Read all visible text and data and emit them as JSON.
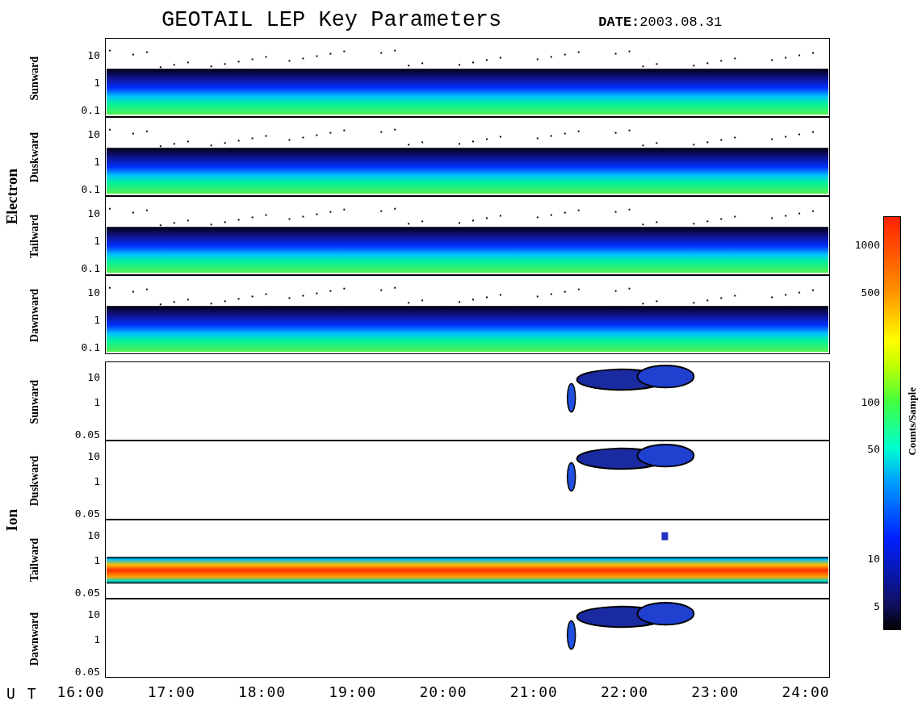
{
  "title": "GEOTAIL LEP Key Parameters",
  "date": {
    "label": "DATE:",
    "value": "2003.08.31"
  },
  "groups": [
    {
      "name": "Electron",
      "panels": [
        {
          "label": "Sunward",
          "kind": "electron",
          "yticks": [
            "10",
            "1",
            "0.1"
          ]
        },
        {
          "label": "Duskward",
          "kind": "electron",
          "yticks": [
            "10",
            "1",
            "0.1"
          ]
        },
        {
          "label": "Tailward",
          "kind": "electron",
          "yticks": [
            "10",
            "1",
            "0.1"
          ]
        },
        {
          "label": "Dawnward",
          "kind": "electron",
          "yticks": [
            "10",
            "1",
            "0.1"
          ]
        }
      ]
    },
    {
      "name": "Ion",
      "panels": [
        {
          "label": "Sunward",
          "kind": "ion-beam",
          "yticks": [
            "10",
            "1",
            "0.05"
          ]
        },
        {
          "label": "Duskward",
          "kind": "ion-beam",
          "yticks": [
            "10",
            "1",
            "0.05"
          ]
        },
        {
          "label": "Tailward",
          "kind": "ion-band",
          "yticks": [
            "10",
            "1",
            "0.05"
          ]
        },
        {
          "label": "Dawnward",
          "kind": "ion-beam",
          "yticks": [
            "10",
            "1",
            "0.05"
          ]
        }
      ]
    }
  ],
  "xaxis": {
    "label": "U T",
    "ticks": [
      "16:00",
      "17:00",
      "18:00",
      "19:00",
      "20:00",
      "21:00",
      "22:00",
      "23:00",
      "24:00"
    ]
  },
  "colorbar": {
    "label": "Counts/Sample",
    "ticks": [
      "1000",
      "500",
      "100",
      "50",
      "10",
      "5"
    ]
  }
}
